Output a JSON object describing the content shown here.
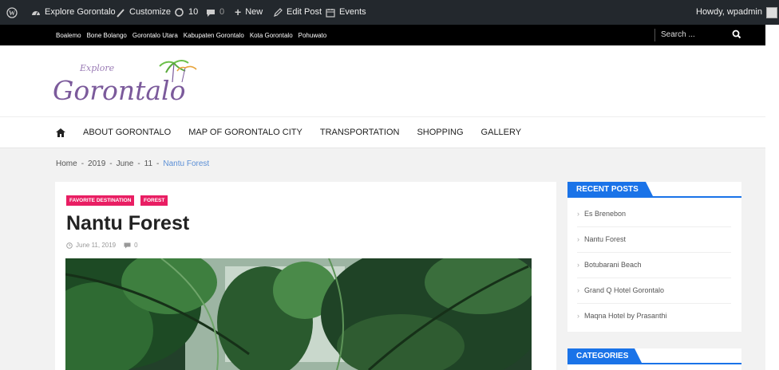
{
  "admin_bar": {
    "site_name": "Explore Gorontalo",
    "customize": "Customize",
    "updates_count": "10",
    "comments_count": "0",
    "new": "New",
    "edit_post": "Edit Post",
    "events": "Events",
    "howdy": "Howdy, wpadmin"
  },
  "top_nav": {
    "links": [
      "Boalemo",
      "Bone Bolango",
      "Gorontalo Utara",
      "Kabupaten Gorontalo",
      "Kota Gorontalo",
      "Pohuwato"
    ],
    "search_placeholder": "Search ..."
  },
  "logo": {
    "script_small": "Explore",
    "script_large": "Gorontalo"
  },
  "main_nav": {
    "items": [
      "ABOUT GORONTALO",
      "MAP OF GORONTALO CITY",
      "TRANSPORTATION",
      "SHOPPING",
      "GALLERY"
    ]
  },
  "breadcrumb": {
    "items": [
      "Home",
      "2019",
      "June",
      "11"
    ],
    "current": "Nantu Forest",
    "separator": "-"
  },
  "post": {
    "tags": [
      "FAVORITE DESTINATION",
      "FOREST"
    ],
    "title": "Nantu Forest",
    "date": "June 11, 2019",
    "comments": "0"
  },
  "sidebar": {
    "recent_posts_title": "RECENT POSTS",
    "recent_posts": [
      "Es Brenebon",
      "Nantu Forest",
      "Botubarani Beach",
      "Grand Q Hotel Gorontalo",
      "Maqna Hotel by Prasanthi"
    ],
    "categories_title": "CATEGORIES"
  },
  "colors": {
    "accent_blue": "#1a73e8",
    "tag_pink": "#e91e63",
    "admin_bar": "#23282d"
  }
}
